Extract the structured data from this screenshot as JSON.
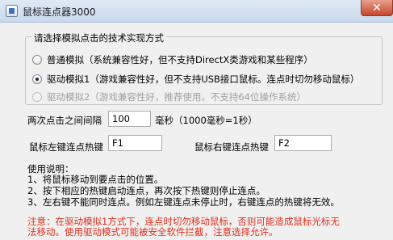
{
  "window": {
    "title": "鼠标连点器3000",
    "close_label": "✕"
  },
  "method_group": {
    "title": "请选择模拟点击的技术实现方式",
    "options": [
      {
        "label": "普通模拟（系统兼容性好，但不支持DirectX类游戏和某些程序）",
        "checked": false,
        "enabled": true
      },
      {
        "label": "驱动模拟1（游戏兼容性好，但不支持USB接口鼠标。连点时切勿移动鼠标）",
        "checked": true,
        "enabled": true
      },
      {
        "label": "驱动模拟2（游戏兼容性好，推荐使用。不支持64位操作系统）",
        "checked": false,
        "enabled": false
      }
    ]
  },
  "interval": {
    "label": "两次点击之间间隔",
    "value": "100",
    "unit_label": "毫秒（1000毫秒=1秒）"
  },
  "hotkeys": {
    "left_label": "鼠标左键连点热键",
    "left_value": "F1",
    "right_label": "鼠标右键连点热键",
    "right_value": "F2"
  },
  "instructions": {
    "heading": "使用说明：",
    "lines": [
      "1、将鼠标移动到要点击的位置。",
      "2、按下相应的热键启动连点，再次按下热键则停止连点。",
      "3、左右键不能同时连点。例如左键连点未停止时，右键连点的热键将无效。"
    ]
  },
  "notice": {
    "lines": [
      "注意：在驱动模拟1方式下，连点时切勿移动鼠标，否则可能造成鼠标光标无",
      "法移动。使用驱动模式可能被安全软件拦截，注意选择允许。"
    ]
  },
  "colors": {
    "notice": "#e0301e",
    "title_bar": "#c9d9ec",
    "close_button": "#c6452c"
  }
}
